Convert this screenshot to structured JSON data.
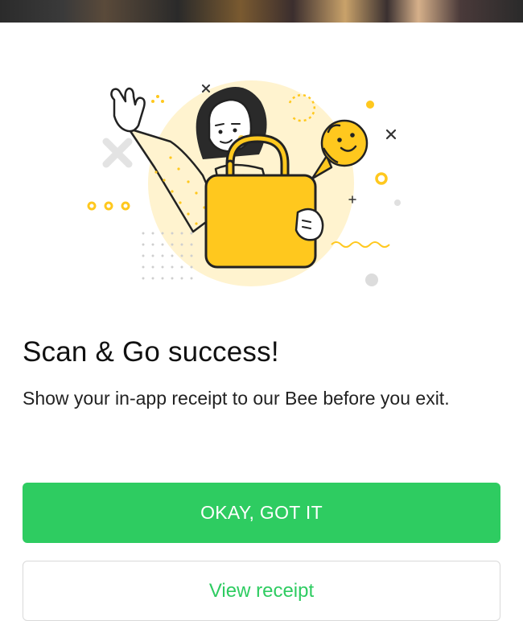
{
  "dialog": {
    "title": "Scan & Go success!",
    "message": "Show your in-app receipt to our Bee before you exit.",
    "primary_button_label": "OKAY, GOT IT",
    "secondary_button_label": "View receipt"
  },
  "illustration": {
    "icons": [
      "woman-waving-icon",
      "shopping-bag-icon",
      "bee-mascot-icon"
    ]
  },
  "colors": {
    "accent_green": "#2ecc61",
    "yellow": "#ffc81e",
    "pale_yellow": "#fff3cf"
  }
}
